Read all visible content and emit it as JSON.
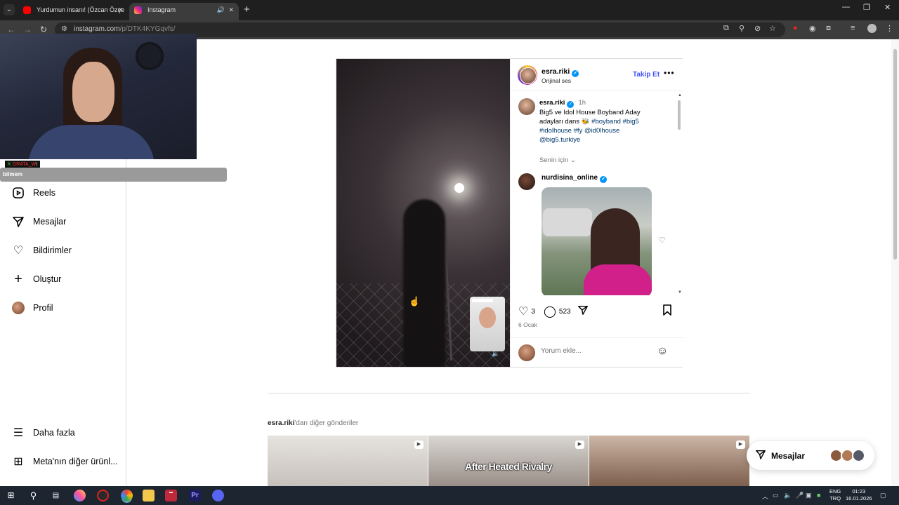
{
  "browser": {
    "tabs": [
      {
        "title": "Yurdumun insanı! (Özcan Özçe",
        "favicon_color": "#ff0000"
      },
      {
        "title": "Instagram",
        "favicon_color": "#d6249f"
      }
    ],
    "url_host": "instagram.com",
    "url_path": "/p/DTK4KYGqvfs/"
  },
  "webcam": {
    "overlay_tag": "GRATA_W",
    "overlay_tag_prefix": "K",
    "overlay_tag_suffix": "t",
    "chat_name": "bilmem"
  },
  "sidebar": {
    "items": [
      {
        "label": "Reels",
        "icon": "reels-icon"
      },
      {
        "label": "Mesajlar",
        "icon": "send-icon"
      },
      {
        "label": "Bildirimler",
        "icon": "heart-icon"
      },
      {
        "label": "Oluştur",
        "icon": "plus-icon"
      },
      {
        "label": "Profil",
        "icon": "avatar"
      }
    ],
    "bottom_items": [
      {
        "label": "Daha fazla",
        "icon": "menu-icon"
      },
      {
        "label": "Meta'nın diğer ürünl...",
        "icon": "grid-icon"
      }
    ]
  },
  "post": {
    "author": "esra.riki",
    "audio_label": "Orijinal ses",
    "follow_label": "Takip Et",
    "caption": {
      "user": "esra.riki",
      "time": "1h",
      "text": "Big5 ve Idol House Boyband Aday adayları dans 🐝",
      "tags": [
        "#boyband",
        "#big5",
        "#idolhouse",
        "#fy",
        "@id0lhouse",
        "@big5.turkiye"
      ]
    },
    "for_you_label": "Senin için",
    "comment_user": "nurdisina_online",
    "likes": "3",
    "comments_count": "523",
    "date": "6 Ocak",
    "comment_placeholder": "Yorum ekle..."
  },
  "more_posts": {
    "title_user": "esra.riki",
    "title_suffix": "'dan diğer gönderiler",
    "thumbs": [
      {
        "caption": ""
      },
      {
        "caption": "After Heated Rivalry"
      },
      {
        "caption": ""
      }
    ]
  },
  "messages_pill": {
    "label": "Mesajlar"
  },
  "taskbar": {
    "lang_top": "ENG",
    "lang_bottom": "TRQ",
    "time": "01:23",
    "date": "16.01.2026"
  }
}
